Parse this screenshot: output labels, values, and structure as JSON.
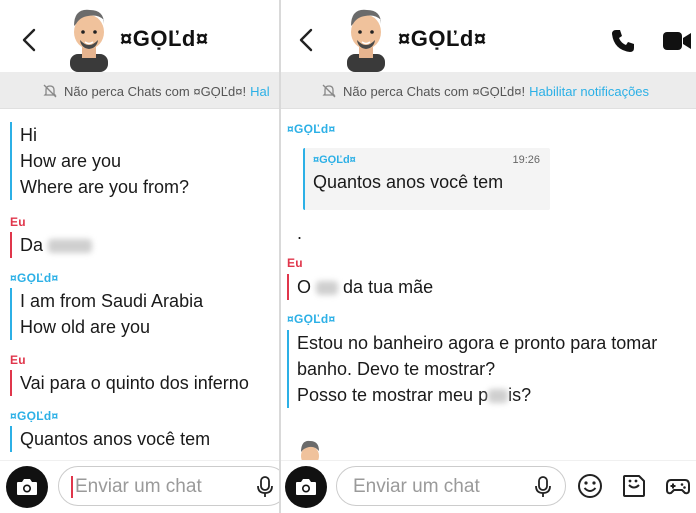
{
  "contact": {
    "name": "¤GỌĽd¤"
  },
  "notice": {
    "text": "Não perca Chats com ¤GỌĽd¤!",
    "left_link": "Hal",
    "right_link": "Habilitar notificações"
  },
  "left_chat": {
    "partner_lines_1": [
      "Hi",
      "How are you",
      "Where are you from?"
    ],
    "me_label": "Eu",
    "partner_label": "¤GỌĽd¤",
    "me_msg_1": "Da",
    "partner_lines_2": [
      "I am from Saudi Arabia",
      "How old are you"
    ],
    "me_msg_2": "Vai para o quinto dos inferno",
    "partner_msg_3": "Quantos anos você tem"
  },
  "right_chat": {
    "partner_label": "¤GỌĽd¤",
    "me_label": "Eu",
    "quote_sender": "¤GỌĽd¤",
    "quote_time": "19:26",
    "quote_text": "Quantos anos você tem",
    "dot_msg": ".",
    "me_msg_a": "O",
    "me_msg_b": "da tua mãe",
    "partner_lines": [
      "Estou no banheiro agora e pronto para tomar",
      "banho. Devo te mostrar?"
    ],
    "partner_last_a": "Posso te mostrar meu p",
    "partner_last_b": "is?"
  },
  "input": {
    "placeholder": "Enviar um chat"
  },
  "icons": [
    "back-icon",
    "bitmoji-avatar",
    "phone-icon",
    "video-icon",
    "bell-off-icon",
    "camera-icon",
    "mic-icon",
    "smiley-icon",
    "sticker-icon",
    "game-controller-icon"
  ],
  "colors": {
    "me": "#e0364b",
    "partner": "#2cb0e6",
    "notice_bg": "#ececec"
  }
}
